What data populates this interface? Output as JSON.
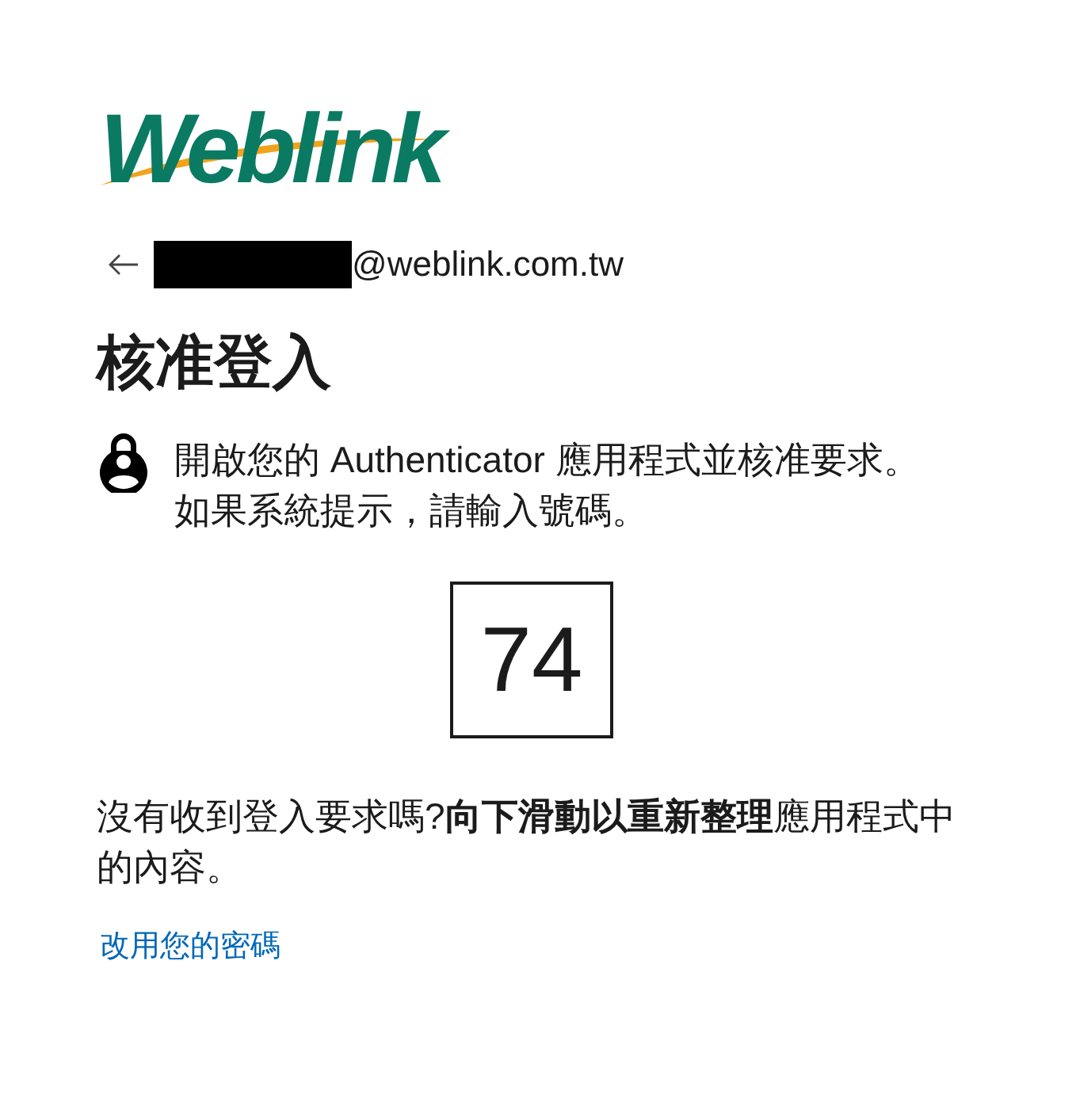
{
  "logo": {
    "text": "Weblink"
  },
  "account": {
    "redacted": true,
    "email": "@weblink.com.tw"
  },
  "title": "核准登入",
  "instruction": "開啟您的 Authenticator 應用程式並核准要求。如果系統提示，請輸入號碼。",
  "number": "74",
  "help_text": "沒有收到登入要求嗎?**向下滑動以重新整理**應用程式中的內容。",
  "link": "改用您的密碼"
}
